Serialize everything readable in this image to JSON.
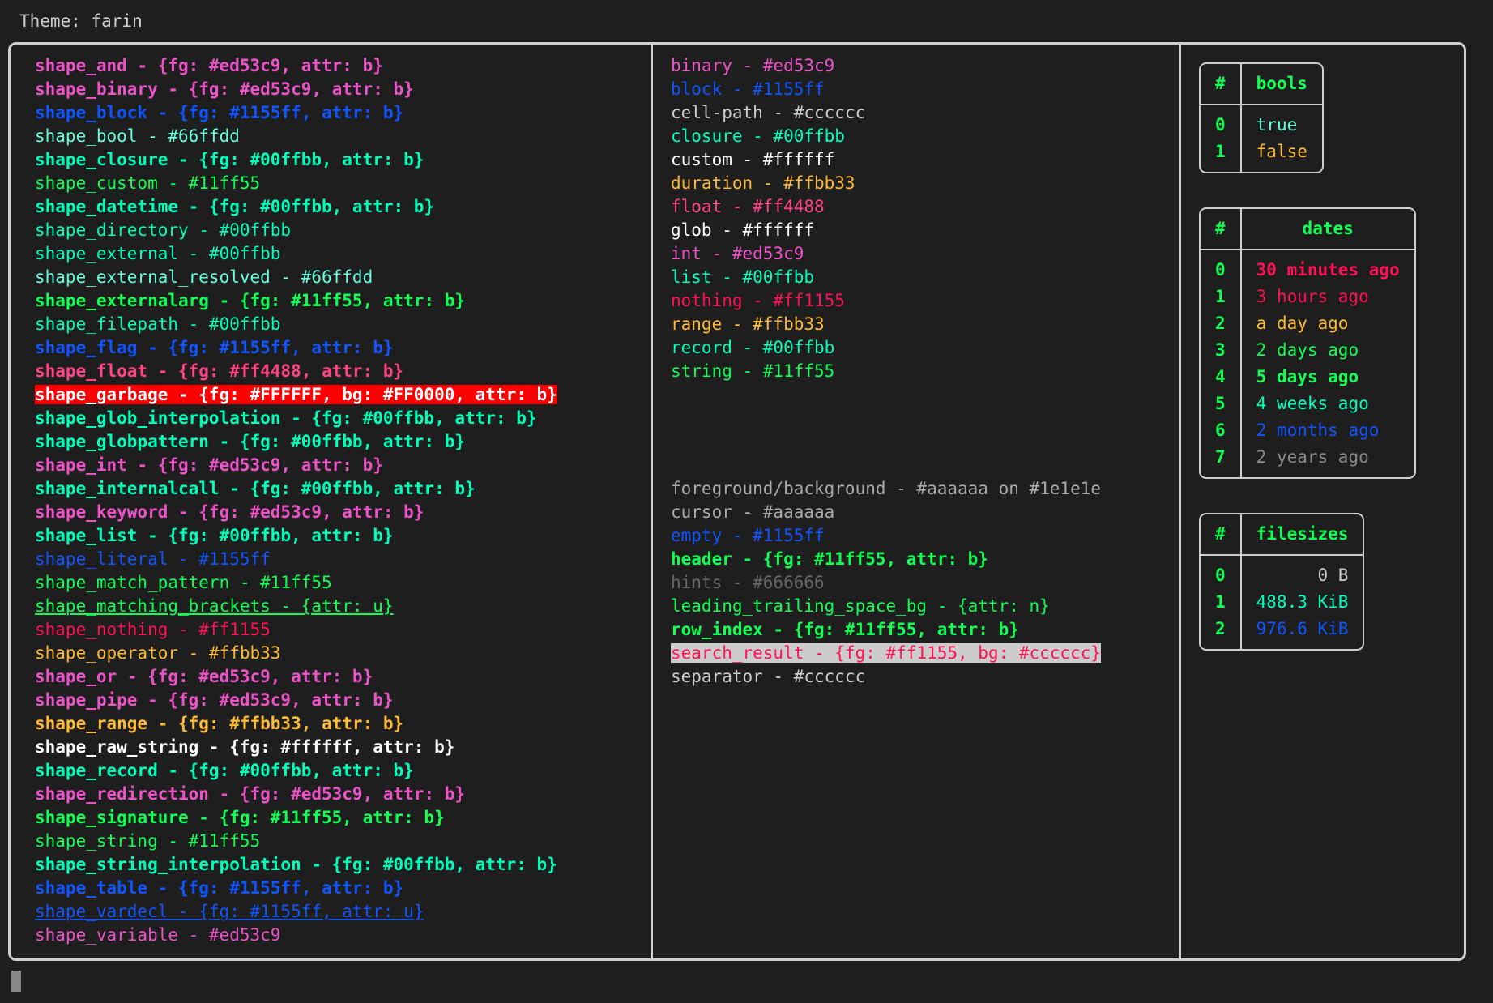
{
  "header": {
    "theme_label": "Theme: farin"
  },
  "palette": {
    "magenta": "#ed53c9",
    "blue": "#1155ff",
    "cyan": "#66ffdd",
    "teal": "#00ffbb",
    "green": "#11ff55",
    "pink": "#ff4488",
    "red": "#ff1155",
    "orange": "#ffbb33",
    "white": "#ffffff",
    "lightgray": "#cccccc",
    "gray": "#aaaaaa",
    "darkgray": "#666666",
    "background": "#1e1e1e",
    "highlight_red_bg": "#FF0000",
    "highlight_gray_bg": "#cccccc"
  },
  "shapes_column": [
    {
      "text": "shape_and - {fg: #ed53c9, attr: b}",
      "color": "#ed53c9",
      "bold": true
    },
    {
      "text": "shape_binary - {fg: #ed53c9, attr: b}",
      "color": "#ed53c9",
      "bold": true
    },
    {
      "text": "shape_block - {fg: #1155ff, attr: b}",
      "color": "#1155ff",
      "bold": true
    },
    {
      "text": "shape_bool - #66ffdd",
      "color": "#66ffdd",
      "bold": false
    },
    {
      "text": "shape_closure - {fg: #00ffbb, attr: b}",
      "color": "#00ffbb",
      "bold": true
    },
    {
      "text": "shape_custom - #11ff55",
      "color": "#11ff55",
      "bold": false
    },
    {
      "text": "shape_datetime - {fg: #00ffbb, attr: b}",
      "color": "#00ffbb",
      "bold": true
    },
    {
      "text": "shape_directory - #00ffbb",
      "color": "#00ffbb",
      "bold": false
    },
    {
      "text": "shape_external - #00ffbb",
      "color": "#00ffbb",
      "bold": false
    },
    {
      "text": "shape_external_resolved - #66ffdd",
      "color": "#66ffdd",
      "bold": false
    },
    {
      "text": "shape_externalarg - {fg: #11ff55, attr: b}",
      "color": "#11ff55",
      "bold": true
    },
    {
      "text": "shape_filepath - #00ffbb",
      "color": "#00ffbb",
      "bold": false
    },
    {
      "text": "shape_flag - {fg: #1155ff, attr: b}",
      "color": "#1155ff",
      "bold": true
    },
    {
      "text": "shape_float - {fg: #ff4488, attr: b}",
      "color": "#ff4488",
      "bold": true
    },
    {
      "text": "shape_garbage - {fg: #FFFFFF, bg: #FF0000, attr: b}",
      "color": "#FFFFFF",
      "bg": "#FF0000",
      "bold": true
    },
    {
      "text": "shape_glob_interpolation - {fg: #00ffbb, attr: b}",
      "color": "#00ffbb",
      "bold": true
    },
    {
      "text": "shape_globpattern - {fg: #00ffbb, attr: b}",
      "color": "#00ffbb",
      "bold": true
    },
    {
      "text": "shape_int - {fg: #ed53c9, attr: b}",
      "color": "#ed53c9",
      "bold": true
    },
    {
      "text": "shape_internalcall - {fg: #00ffbb, attr: b}",
      "color": "#00ffbb",
      "bold": true
    },
    {
      "text": "shape_keyword - {fg: #ed53c9, attr: b}",
      "color": "#ed53c9",
      "bold": true
    },
    {
      "text": "shape_list - {fg: #00ffbb, attr: b}",
      "color": "#00ffbb",
      "bold": true
    },
    {
      "text": "shape_literal - #1155ff",
      "color": "#1155ff",
      "bold": false
    },
    {
      "text": "shape_match_pattern - #11ff55",
      "color": "#11ff55",
      "bold": false
    },
    {
      "text": "shape_matching_brackets - {attr: u}",
      "color": "#11ff55",
      "bold": false,
      "underline": true
    },
    {
      "text": "shape_nothing - #ff1155",
      "color": "#ff1155",
      "bold": false
    },
    {
      "text": "shape_operator - #ffbb33",
      "color": "#ffbb33",
      "bold": false
    },
    {
      "text": "shape_or - {fg: #ed53c9, attr: b}",
      "color": "#ed53c9",
      "bold": true
    },
    {
      "text": "shape_pipe - {fg: #ed53c9, attr: b}",
      "color": "#ed53c9",
      "bold": true
    },
    {
      "text": "shape_range - {fg: #ffbb33, attr: b}",
      "color": "#ffbb33",
      "bold": true
    },
    {
      "text": "shape_raw_string - {fg: #ffffff, attr: b}",
      "color": "#ffffff",
      "bold": true
    },
    {
      "text": "shape_record - {fg: #00ffbb, attr: b}",
      "color": "#00ffbb",
      "bold": true
    },
    {
      "text": "shape_redirection - {fg: #ed53c9, attr: b}",
      "color": "#ed53c9",
      "bold": true
    },
    {
      "text": "shape_signature - {fg: #11ff55, attr: b}",
      "color": "#11ff55",
      "bold": true
    },
    {
      "text": "shape_string - #11ff55",
      "color": "#11ff55",
      "bold": false
    },
    {
      "text": "shape_string_interpolation - {fg: #00ffbb, attr: b}",
      "color": "#00ffbb",
      "bold": true
    },
    {
      "text": "shape_table - {fg: #1155ff, attr: b}",
      "color": "#1155ff",
      "bold": true
    },
    {
      "text": "shape_vardecl - {fg: #1155ff, attr: u}",
      "color": "#1155ff",
      "bold": false,
      "underline": true
    },
    {
      "text": "shape_variable - #ed53c9",
      "color": "#ed53c9",
      "bold": false
    }
  ],
  "types_column": [
    {
      "text": "binary - #ed53c9",
      "color": "#ed53c9",
      "bold": false
    },
    {
      "text": "block - #1155ff",
      "color": "#1155ff",
      "bold": false
    },
    {
      "text": "cell-path - #cccccc",
      "color": "#cccccc",
      "bold": false
    },
    {
      "text": "closure - #00ffbb",
      "color": "#00ffbb",
      "bold": false
    },
    {
      "text": "custom - #ffffff",
      "color": "#ffffff",
      "bold": false
    },
    {
      "text": "duration - #ffbb33",
      "color": "#ffbb33",
      "bold": false
    },
    {
      "text": "float - #ff4488",
      "color": "#ff4488",
      "bold": false
    },
    {
      "text": "glob - #ffffff",
      "color": "#ffffff",
      "bold": false
    },
    {
      "text": "int - #ed53c9",
      "color": "#ed53c9",
      "bold": false
    },
    {
      "text": "list - #00ffbb",
      "color": "#00ffbb",
      "bold": false
    },
    {
      "text": "nothing - #ff1155",
      "color": "#ff1155",
      "bold": false
    },
    {
      "text": "range - #ffbb33",
      "color": "#ffbb33",
      "bold": false
    },
    {
      "text": "record - #00ffbb",
      "color": "#00ffbb",
      "bold": false
    },
    {
      "text": "string - #11ff55",
      "color": "#11ff55",
      "bold": false
    }
  ],
  "ui_column": [
    {
      "text": "foreground/background - #aaaaaa on #1e1e1e",
      "color": "#aaaaaa",
      "bold": false
    },
    {
      "text": "cursor - #aaaaaa",
      "color": "#aaaaaa",
      "bold": false
    },
    {
      "text": "empty - #1155ff",
      "color": "#1155ff",
      "bold": false
    },
    {
      "text": "header - {fg: #11ff55, attr: b}",
      "color": "#11ff55",
      "bold": true
    },
    {
      "text": "hints - #666666",
      "color": "#666666",
      "bold": false
    },
    {
      "text": "leading_trailing_space_bg - {attr: n}",
      "color": "#11ff55",
      "bold": false
    },
    {
      "text": "row_index - {fg: #11ff55, attr: b}",
      "color": "#11ff55",
      "bold": true
    },
    {
      "text": "search_result - {fg: #ff1155, bg: #cccccc}",
      "color": "#ff1155",
      "bg": "#cccccc",
      "bold": false
    },
    {
      "text": "separator - #cccccc",
      "color": "#cccccc",
      "bold": false
    }
  ],
  "tables": [
    {
      "name": "bools",
      "index_header": "#",
      "value_header": "bools",
      "align": "left",
      "rows": [
        {
          "index": "0",
          "value": "true",
          "color": "#66ffdd",
          "bold": false
        },
        {
          "index": "1",
          "value": "false",
          "color": "#ffbb33",
          "bold": false
        }
      ]
    },
    {
      "name": "dates",
      "index_header": "#",
      "value_header": "dates",
      "align": "left",
      "rows": [
        {
          "index": "0",
          "value": "30 minutes ago",
          "color": "#ff1155",
          "bold": true
        },
        {
          "index": "1",
          "value": "3 hours ago",
          "color": "#ff1155",
          "bold": false
        },
        {
          "index": "2",
          "value": "a day ago",
          "color": "#ffbb33",
          "bold": false
        },
        {
          "index": "3",
          "value": "2 days ago",
          "color": "#11ff55",
          "bold": false
        },
        {
          "index": "4",
          "value": "5 days ago",
          "color": "#11ff55",
          "bold": true
        },
        {
          "index": "5",
          "value": "4 weeks ago",
          "color": "#00ffbb",
          "bold": false
        },
        {
          "index": "6",
          "value": "2 months ago",
          "color": "#1155ff",
          "bold": false
        },
        {
          "index": "7",
          "value": "2 years ago",
          "color": "#888888",
          "bold": false
        }
      ]
    },
    {
      "name": "filesizes",
      "index_header": "#",
      "value_header": "filesizes",
      "align": "right",
      "rows": [
        {
          "index": "0",
          "value": "0 B",
          "color": "#cccccc",
          "bold": false
        },
        {
          "index": "1",
          "value": "488.3 KiB",
          "color": "#00ffbb",
          "bold": false
        },
        {
          "index": "2",
          "value": "976.6 KiB",
          "color": "#1155ff",
          "bold": false
        }
      ]
    }
  ]
}
